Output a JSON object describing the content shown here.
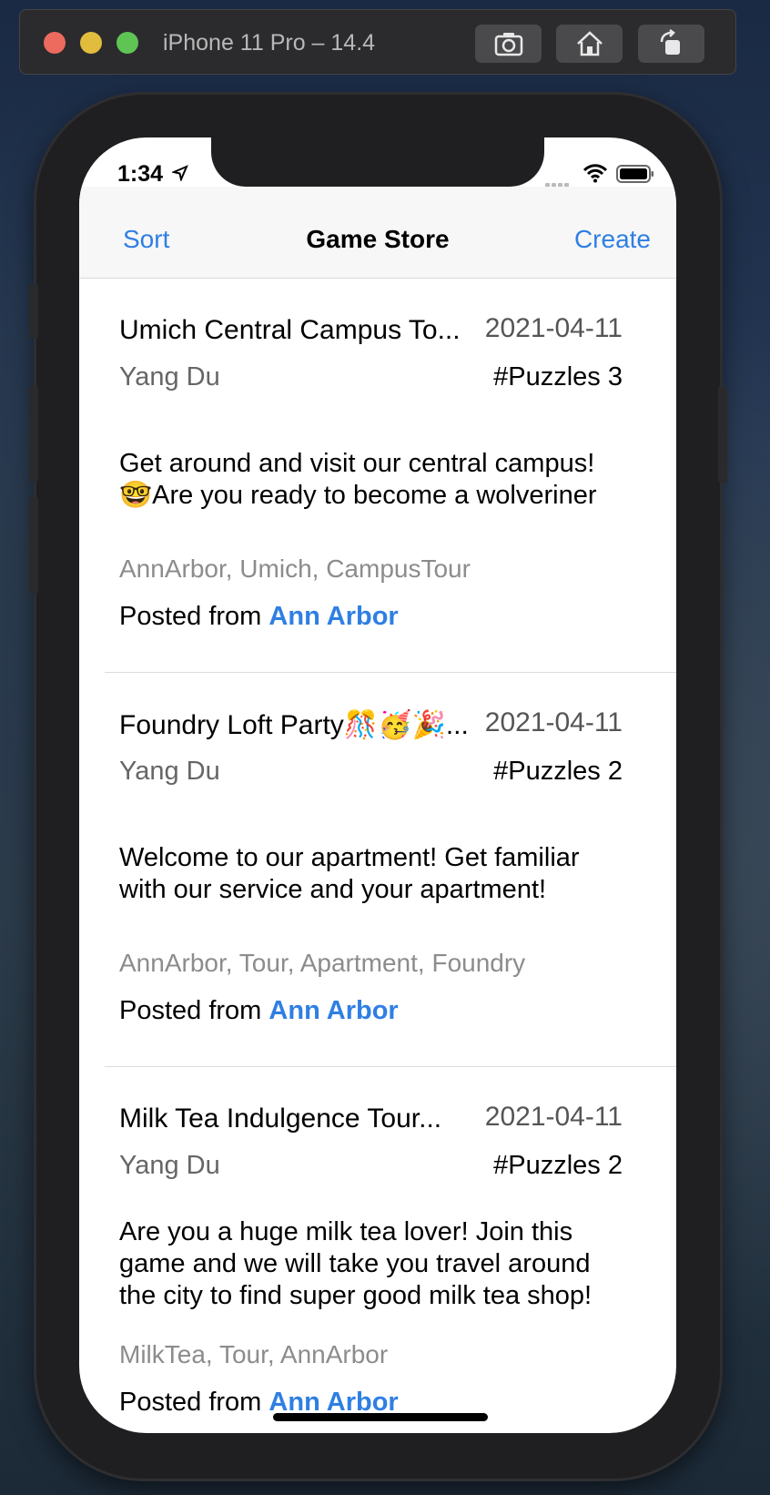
{
  "simulator": {
    "title": "iPhone 11 Pro – 14.4",
    "buttons": [
      "screenshot-icon",
      "home-icon",
      "rotate-icon"
    ]
  },
  "status_bar": {
    "time": "1:34"
  },
  "navbar": {
    "left": "Sort",
    "title": "Game Store",
    "right": "Create"
  },
  "games": [
    {
      "title": "Umich Central Campus To...",
      "date": "2021-04-11",
      "author": "Yang Du",
      "puzzles": "#Puzzles 3",
      "description": "Get around and visit our central campus! 🤓Are you ready to become a wolveriner",
      "tags": "AnnArbor, Umich, CampusTour",
      "posted_prefix": "Posted from ",
      "location": "Ann Arbor"
    },
    {
      "title": "Foundry Loft Party🎊🥳🎉...",
      "date": "2021-04-11",
      "author": "Yang Du",
      "puzzles": "#Puzzles 2",
      "description": "Welcome to our apartment! Get familiar with our service and your apartment!",
      "tags": "AnnArbor, Tour, Apartment, Foundry",
      "posted_prefix": "Posted from ",
      "location": "Ann Arbor"
    },
    {
      "title": "Milk Tea Indulgence Tour...",
      "date": "2021-04-11",
      "author": "Yang Du",
      "puzzles": "#Puzzles 2",
      "description": "Are you a huge milk tea lover! Join this game and we will take you travel around the city to find super good milk tea shop!",
      "tags": "MilkTea, Tour, AnnArbor",
      "posted_prefix": "Posted from ",
      "location": "Ann Arbor"
    }
  ],
  "colors": {
    "accent": "#2f7fe3",
    "secondary_text": "#8c8c8c"
  }
}
